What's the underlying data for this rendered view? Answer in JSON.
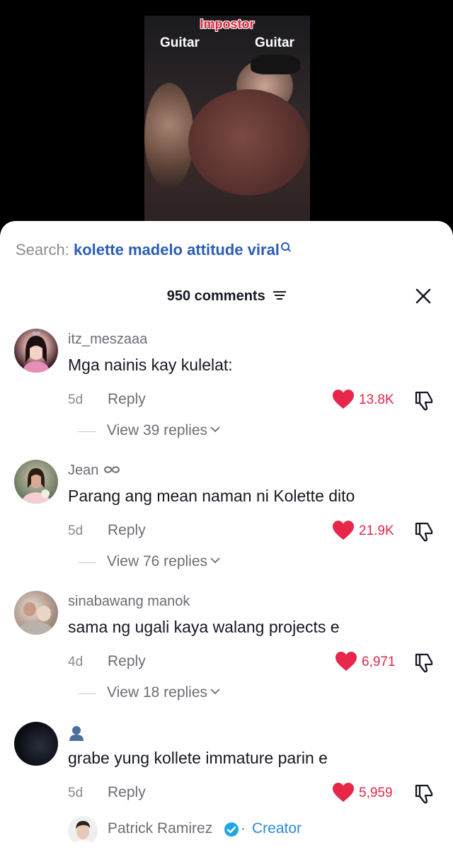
{
  "video": {
    "overlay_title": "Impostor",
    "label_left": "Guitar",
    "label_right": "Guitar"
  },
  "search": {
    "prefix": "Search:",
    "term": "kolette madelo attitude viral"
  },
  "header": {
    "count_label": "950 comments"
  },
  "comments": [
    {
      "username": "itz_meszaaa",
      "text": "Mga nainis kay kulelat:",
      "time": "5d",
      "reply_label": "Reply",
      "likes": "13.8K",
      "view_replies": "View 39 replies"
    },
    {
      "username": "Jean",
      "username_suffix_icon": "infinity-icon",
      "text": "Parang ang mean naman ni Kolette dito",
      "time": "5d",
      "reply_label": "Reply",
      "likes": "21.9K",
      "view_replies": "View 76 replies"
    },
    {
      "username": "sinabawang manok",
      "text": "sama ng ugali kaya walang projects e",
      "time": "4d",
      "reply_label": "Reply",
      "likes": "6,971",
      "view_replies": "View 18 replies"
    },
    {
      "username": "",
      "username_icon": "person-icon",
      "text": "grabe yung kollete immature parin e",
      "time": "5d",
      "reply_label": "Reply",
      "likes": "5,959"
    }
  ],
  "creator_reply": {
    "name": "Patrick Ramirez",
    "separator": "·",
    "badge": "Creator"
  },
  "colors": {
    "accent_like": "#e0264a",
    "search_term": "#2b5db6",
    "creator_badge": "#2b8bd6"
  }
}
